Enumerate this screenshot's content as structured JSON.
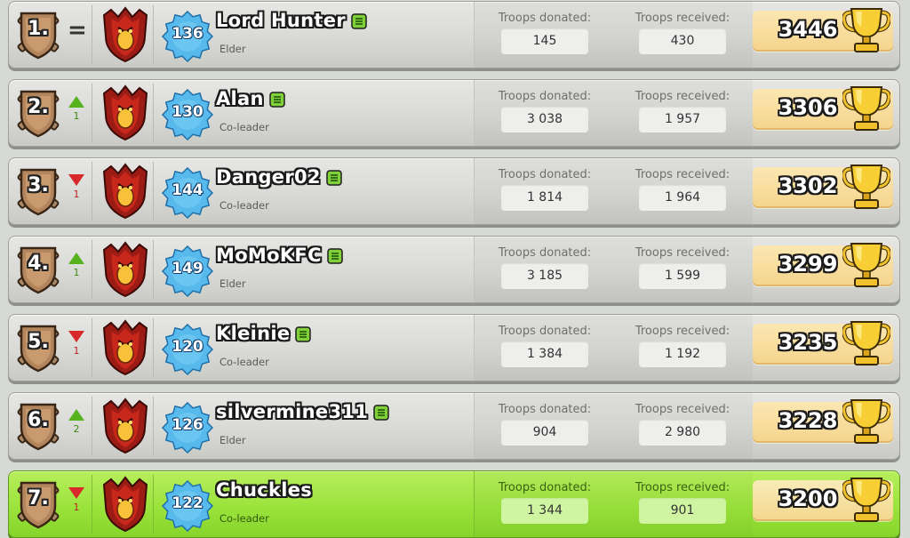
{
  "labels": {
    "donated": "Troops donated:",
    "received": "Troops received:"
  },
  "colors": {
    "highlight_row": "#9be33c",
    "trend_up": "#56b21d",
    "trend_down": "#d82a2a",
    "trophy_box": "#f5d48c"
  },
  "members": [
    {
      "rank": "1.",
      "trend": "same",
      "trend_symbol": "=",
      "trend_count": "",
      "level": "136",
      "name": "Lord Hunter",
      "role": "Elder",
      "donated": "145",
      "received": "430",
      "trophies": "3446",
      "highlight": false
    },
    {
      "rank": "2.",
      "trend": "up",
      "trend_symbol": "",
      "trend_count": "1",
      "level": "130",
      "name": "Alan",
      "role": "Co-leader",
      "donated": "3 038",
      "received": "1 957",
      "trophies": "3306",
      "highlight": false
    },
    {
      "rank": "3.",
      "trend": "down",
      "trend_symbol": "",
      "trend_count": "1",
      "level": "144",
      "name": "Danger02",
      "role": "Co-leader",
      "donated": "1 814",
      "received": "1 964",
      "trophies": "3302",
      "highlight": false
    },
    {
      "rank": "4.",
      "trend": "up",
      "trend_symbol": "",
      "trend_count": "1",
      "level": "149",
      "name": "MoMoKFC",
      "role": "Elder",
      "donated": "3 185",
      "received": "1 599",
      "trophies": "3299",
      "highlight": false
    },
    {
      "rank": "5.",
      "trend": "down",
      "trend_symbol": "",
      "trend_count": "1",
      "level": "120",
      "name": "Kleinie",
      "role": "Co-leader",
      "donated": "1 384",
      "received": "1 192",
      "trophies": "3235",
      "highlight": false
    },
    {
      "rank": "6.",
      "trend": "up",
      "trend_symbol": "",
      "trend_count": "2",
      "level": "126",
      "name": "silvermine311",
      "role": "Elder",
      "donated": "904",
      "received": "2 980",
      "trophies": "3228",
      "highlight": false
    },
    {
      "rank": "7.",
      "trend": "down",
      "trend_symbol": "",
      "trend_count": "1",
      "level": "122",
      "name": "Chuckles",
      "role": "Co-leader",
      "donated": "1 344",
      "received": "901",
      "trophies": "3200",
      "highlight": true
    }
  ]
}
